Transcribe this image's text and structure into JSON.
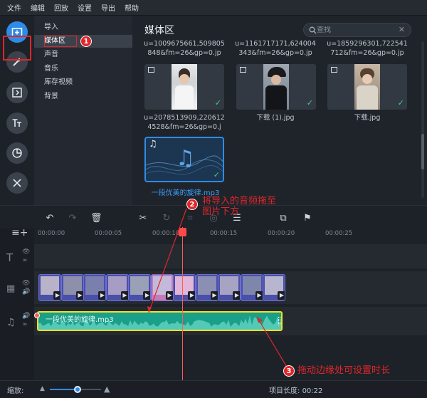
{
  "menu": [
    "文件",
    "编辑",
    "回放",
    "设置",
    "导出",
    "帮助"
  ],
  "categories": [
    {
      "label": "导入"
    },
    {
      "label": "媒体区"
    },
    {
      "label": "声音"
    },
    {
      "label": "音乐"
    },
    {
      "label": "库存视频"
    },
    {
      "label": "背景"
    }
  ],
  "media": {
    "title": "媒体区",
    "search_placeholder": "查找",
    "files": [
      {
        "name": "u=1009675661,509805848&fm=26&gp=0.jp"
      },
      {
        "name": "u=1161717171,624004343&fm=26&gp=0.jp"
      },
      {
        "name": "u=1859296301,722541712&fm=26&gp=0.jp"
      },
      {
        "name": "u=2078513909,2206124528&fm=26&gp=0.j"
      },
      {
        "name": "下载 (1).jpg"
      },
      {
        "name": "下载.jpg"
      }
    ],
    "audio_file": "一段优美的旋律.mp3"
  },
  "ruler_labels": [
    "00:00:00",
    "00:00:05",
    "00:00:10",
    "00:00:15",
    "00:00:20",
    "00:00:25"
  ],
  "timeline": {
    "audio_clip_label": "一段优美的旋律.mp3"
  },
  "annotations": {
    "badge1": "1",
    "badge2": "2",
    "badge3": "3",
    "note2_line1": "将导入的音频拖至",
    "note2_line2": "图片下方",
    "note3": "拖动边缘处可设置时长"
  },
  "status": {
    "zoom_label": "缩放:",
    "zoom_level": 0.5,
    "project_length_label": "项目长度:",
    "project_length": "00:22"
  },
  "colors": {
    "accent": "#2f8ce6",
    "annotation_red": "#e0262a",
    "audio_clip": "#1a9f8a",
    "selection_yellow": "#f3e11c"
  }
}
